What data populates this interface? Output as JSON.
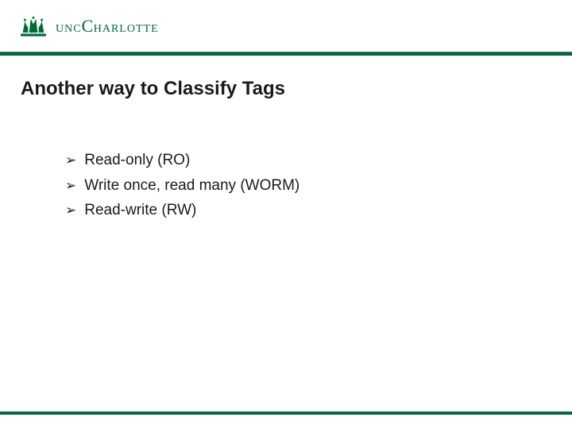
{
  "brand": {
    "name": "UNC Charlotte",
    "wordmark_prefix": "UNC",
    "wordmark_bigC": "C",
    "wordmark_suffix": "HARLOTTE",
    "color_primary": "#006a3a"
  },
  "slide": {
    "title": "Another way to Classify Tags",
    "bullets": [
      "Read-only (RO)",
      "Write once, read many (WORM)",
      "Read-write (RW)"
    ]
  }
}
